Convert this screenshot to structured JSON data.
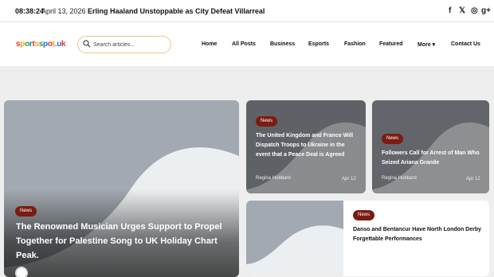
{
  "topbar": {
    "time": "08:38:24",
    "date": "April 13, 2026",
    "ticker": "Erling Haaland Unstoppable as City Defeat Villarreal",
    "social_icons": [
      "facebook-icon",
      "twitter-icon",
      "instagram-icon",
      "google-plus-icon"
    ],
    "social_glyphs": [
      "f",
      "𝕏",
      "◎",
      "g+"
    ]
  },
  "header": {
    "logo": "sportsspot.uk",
    "logo_colors": [
      "#e2362b",
      "#f2a81d",
      "#2aa14a",
      "#1c6fd1"
    ],
    "search_placeholder": "Search articles...",
    "nav": [
      "Home",
      "All Posts",
      "Business",
      "Esports",
      "Fashion",
      "Featured",
      "More ▾",
      "Contact Us"
    ]
  },
  "cards": {
    "featured": {
      "category": "News",
      "title": "The Renowned Musician Urges Support to Propel Together for Palestine Song to UK Holiday Chart Peak."
    },
    "top_middle": {
      "category": "News",
      "title": "The United Kingdom and France Will Dispatch Troops to Ukraine in the event that a Peace Deal is Agreed",
      "author": "Regina Hubbard",
      "date": "Apr 12"
    },
    "top_right": {
      "category": "News",
      "title": "Followers Call for Arrest of Man Who Seized Ariana Grande",
      "author": "Regina Hubbard",
      "date": "Apr 12"
    },
    "bottom": {
      "category": "News",
      "title": "Danso and Bentancur Have North London Derby Forgettable Performances"
    }
  },
  "colors": {
    "badge": "#7a1c12",
    "search_border": "#f0c58a",
    "placeholder_bg": "#a3a9b0",
    "placeholder_shape": "#eceff1"
  }
}
